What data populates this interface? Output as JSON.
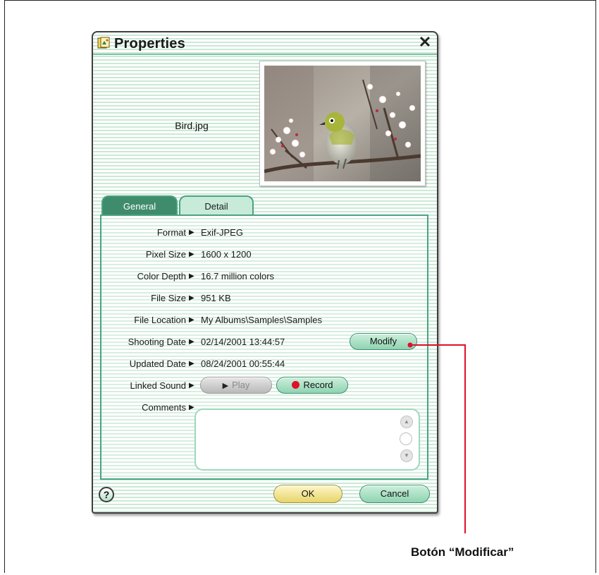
{
  "window": {
    "title": "Properties",
    "file_name": "Bird.jpg"
  },
  "tabs": [
    {
      "label": "General",
      "active": true
    },
    {
      "label": "Detail",
      "active": false
    }
  ],
  "properties": {
    "format": {
      "label": "Format",
      "value": "Exif-JPEG"
    },
    "pixel_size": {
      "label": "Pixel Size",
      "value": "1600 x 1200"
    },
    "color_depth": {
      "label": "Color Depth",
      "value": "16.7 million colors"
    },
    "file_size": {
      "label": "File Size",
      "value": "951 KB"
    },
    "file_location": {
      "label": "File Location",
      "value": "My Albums\\Samples\\Samples"
    },
    "shooting_date": {
      "label": "Shooting Date",
      "value": "02/14/2001 13:44:57"
    },
    "updated_date": {
      "label": "Updated Date",
      "value": "08/24/2001 00:55:44"
    },
    "linked_sound": {
      "label": "Linked Sound"
    },
    "comments": {
      "label": "Comments",
      "value": ""
    }
  },
  "buttons": {
    "modify": "Modify",
    "play": "Play",
    "record": "Record",
    "ok": "OK",
    "cancel": "Cancel",
    "help": "?"
  },
  "callout": {
    "text": "Botón “Modificar”",
    "color": "#e0102a"
  },
  "icons": {
    "close": "close-icon",
    "help": "help-icon",
    "app": "properties-app-icon",
    "arrow": "arrow-right-icon"
  }
}
